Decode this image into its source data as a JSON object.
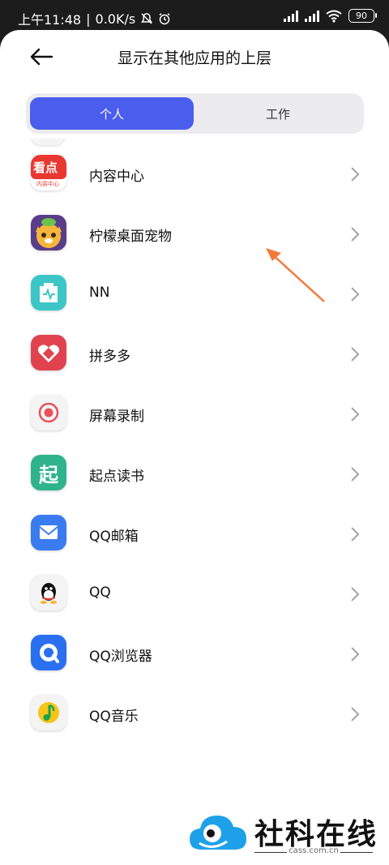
{
  "status_bar": {
    "time": "上午11:48",
    "speed": "0.0K/s",
    "battery": "90"
  },
  "header": {
    "title": "显示在其他应用的上层"
  },
  "tabs": [
    {
      "label": "个人",
      "active": true
    },
    {
      "label": "工作",
      "active": false
    }
  ],
  "apps": [
    {
      "name": "内容中心",
      "icon": "kandian-icon",
      "icon_text": "看点",
      "icon_subtext": "内容中心"
    },
    {
      "name": "柠檬桌面宠物",
      "icon": "lemon-pet-icon"
    },
    {
      "name": "NN",
      "icon": "nn-icon"
    },
    {
      "name": "拼多多",
      "icon": "pinduoduo-icon"
    },
    {
      "name": "屏幕录制",
      "icon": "screen-record-icon"
    },
    {
      "name": "起点读书",
      "icon": "qidian-icon",
      "icon_text": "起"
    },
    {
      "name": "QQ邮箱",
      "icon": "qq-mail-icon"
    },
    {
      "name": "QQ",
      "icon": "qq-icon"
    },
    {
      "name": "QQ浏览器",
      "icon": "qq-browser-icon"
    },
    {
      "name": "QQ音乐",
      "icon": "qq-music-icon"
    }
  ],
  "colors": {
    "accent": "#4b5ded",
    "annotation_arrow": "#f07a3a"
  },
  "watermark": {
    "text": "社科在线",
    "domain": "cass.com.cn"
  }
}
